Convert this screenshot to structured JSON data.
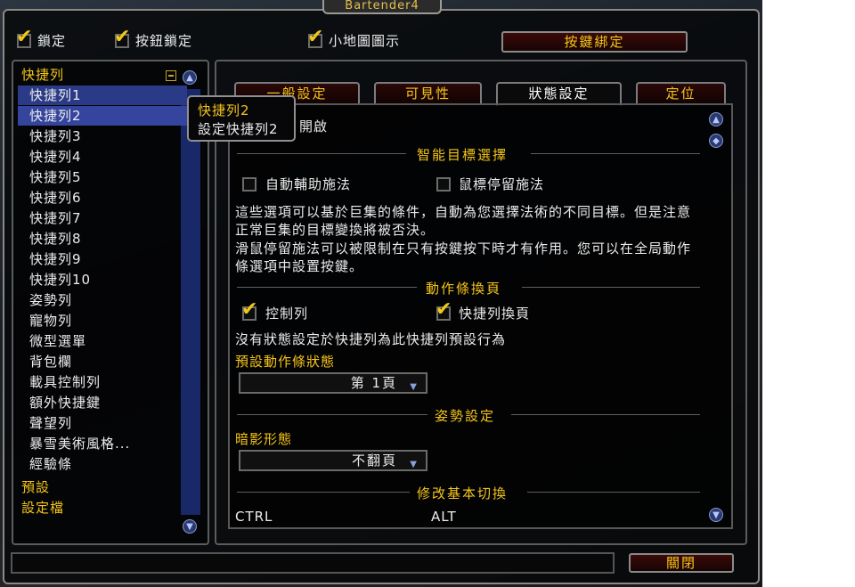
{
  "window": {
    "title": "Bartender4"
  },
  "top_options": {
    "lock": {
      "label": "鎖定",
      "checked": true
    },
    "button_lock": {
      "label": "按鈕鎖定",
      "checked": true
    },
    "minimap_icon": {
      "label": "小地圖圖示",
      "checked": true
    },
    "keybind_button": "按鍵綁定"
  },
  "tree": {
    "root_label": "快捷列",
    "collapse_icon": "minus-icon",
    "items": [
      "快捷列1",
      "快捷列2",
      "快捷列3",
      "快捷列4",
      "快捷列5",
      "快捷列6",
      "快捷列7",
      "快捷列8",
      "快捷列9",
      "快捷列10",
      "姿勢列",
      "寵物列",
      "微型選單",
      "背包欄",
      "載具控制列",
      "額外快捷鍵",
      "聲望列",
      "暴雪美術風格...",
      "經驗條"
    ],
    "selected": "快捷列2",
    "footer_items": [
      "預設",
      "設定檔"
    ]
  },
  "tooltip": {
    "title": "快捷列2",
    "text": "設定快捷列2"
  },
  "tabs": [
    "一般設定",
    "可見性",
    "狀態設定",
    "定位"
  ],
  "active_tab": "狀態設定",
  "content": {
    "enable_partial": "開啟",
    "smart_target": {
      "title": "智能目標選擇",
      "auto_assist": {
        "label": "自動輔助施法",
        "checked": false
      },
      "mouseover": {
        "label": "鼠標停留施法",
        "checked": false
      },
      "desc1": "這些選項可以基於巨集的條件，自動為您選擇法術的不同目標。但是注意正常巨集的目標變換將被否決。",
      "desc2": "滑鼠停留施法可以被限制在只有按鍵按下時才有作用。您可以在全局動作條選項中設置按鍵。"
    },
    "action_paging": {
      "title": "動作條換頁",
      "control_bar": {
        "label": "控制列",
        "checked": true
      },
      "bar_paging": {
        "label": "快捷列換頁",
        "checked": true
      },
      "note": "沒有狀態設定於快捷列為此快捷列預設行為",
      "default_state_label": "預設動作條狀態",
      "default_state_value": "第 1頁"
    },
    "stance": {
      "title": "姿勢設定",
      "shadow_label": "暗影形態",
      "shadow_value": "不翻頁"
    },
    "modifiers": {
      "title": "修改基本切換",
      "ctrl": "CTRL",
      "alt": "ALT"
    }
  },
  "footer": {
    "close_button": "關閉"
  },
  "colors": {
    "gold": "#f5c518",
    "selection": "#35459e",
    "scroll": "#182868"
  }
}
